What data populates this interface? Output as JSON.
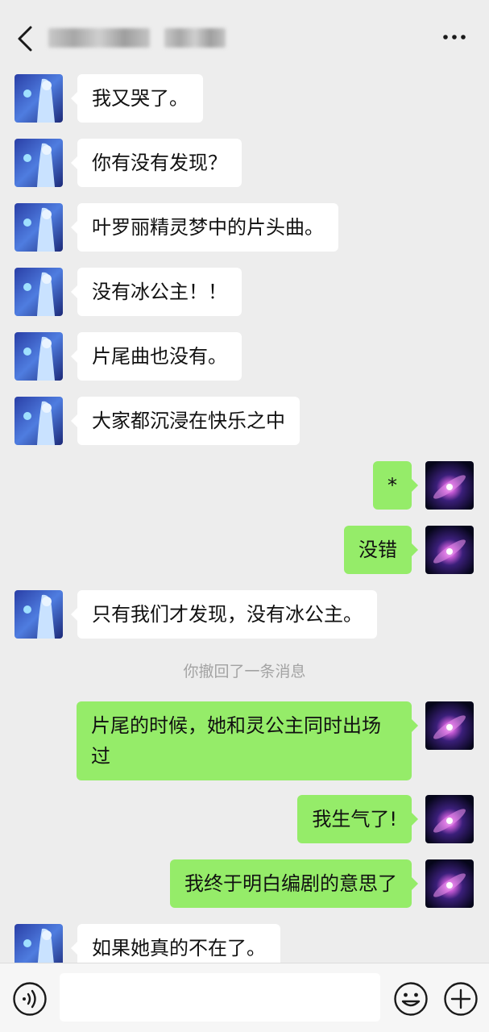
{
  "header": {
    "title_obscured": true,
    "back_icon": "chevron-left-icon",
    "more_icon": "more-dots-icon"
  },
  "messages": [
    {
      "side": "in",
      "text": "我又哭了。"
    },
    {
      "side": "in",
      "text": "你有没有发现？"
    },
    {
      "side": "in",
      "text": "叶罗丽精灵梦中的片头曲。"
    },
    {
      "side": "in",
      "text": "没有冰公主！！"
    },
    {
      "side": "in",
      "text": "片尾曲也没有。"
    },
    {
      "side": "in",
      "text": "大家都沉浸在快乐之中"
    },
    {
      "side": "out",
      "text": "*"
    },
    {
      "side": "out",
      "text": "没错"
    },
    {
      "side": "in",
      "text": "只有我们才发现，没有冰公主。"
    },
    {
      "side": "system",
      "text": "你撤回了一条消息"
    },
    {
      "side": "out",
      "text": "片尾的时候，她和灵公主同时出场过"
    },
    {
      "side": "out",
      "text": "我生气了!"
    },
    {
      "side": "out",
      "text": "我终于明白编剧的意思了"
    },
    {
      "side": "in",
      "text": "如果她真的不在了。"
    }
  ],
  "input_bar": {
    "voice_icon": "voice-icon",
    "emoji_icon": "emoji-icon",
    "plus_icon": "plus-icon",
    "input_value": ""
  },
  "colors": {
    "background": "#ededed",
    "incoming_bubble": "#ffffff",
    "outgoing_bubble": "#95ec69",
    "system_text": "#a3a3a3"
  }
}
